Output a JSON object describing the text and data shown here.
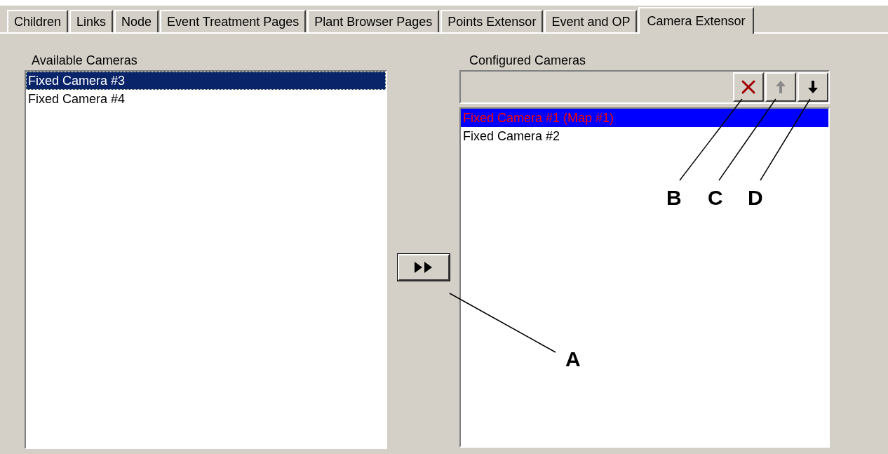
{
  "tabs": [
    {
      "label": "Children",
      "selected": false
    },
    {
      "label": "Links",
      "selected": false
    },
    {
      "label": "Node",
      "selected": false
    },
    {
      "label": "Event Treatment Pages",
      "selected": false
    },
    {
      "label": "Plant Browser Pages",
      "selected": false
    },
    {
      "label": "Points Extensor",
      "selected": false
    },
    {
      "label": "Event and OP",
      "selected": false
    },
    {
      "label": "Camera Extensor",
      "selected": true
    }
  ],
  "available_cameras": {
    "label": "Available Cameras",
    "items": [
      {
        "text": "Fixed Camera #3",
        "selected": true
      },
      {
        "text": "Fixed Camera #4",
        "selected": false
      }
    ]
  },
  "add_button": {
    "kind": "add"
  },
  "configured_cameras": {
    "label": "Configured Cameras",
    "toolbar": [
      {
        "kind": "delete",
        "disabled": false
      },
      {
        "kind": "up",
        "disabled": true
      },
      {
        "kind": "down",
        "disabled": false
      }
    ],
    "items": [
      {
        "text": "Fixed Camera #1 (Map #1)",
        "selected": true,
        "color": "#ff0000"
      },
      {
        "text": "Fixed Camera #2",
        "selected": false,
        "color": "#000000"
      }
    ]
  },
  "callouts": [
    {
      "label": "A"
    },
    {
      "label": "B"
    },
    {
      "label": "C"
    },
    {
      "label": "D"
    }
  ]
}
